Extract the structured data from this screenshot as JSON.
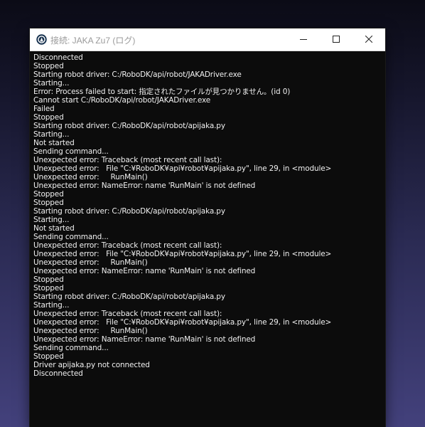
{
  "window": {
    "title": "接続: JAKA Zu7 (ログ)",
    "app_icon": "robodk-logo-icon",
    "controls": {
      "minimize": "minimize-icon",
      "maximize": "maximize-icon",
      "close": "close-icon"
    }
  },
  "colors": {
    "console_background": "#0c0c0c",
    "console_text": "#f0f0f0",
    "titlebar_background": "#ffffff",
    "title_text": "#9a9a9a"
  },
  "log_lines": [
    "Disconnected",
    "Stopped",
    "Starting robot driver: C:/RoboDK/api/robot/JAKADriver.exe",
    "Starting...",
    "Error: Process failed to start: 指定されたファイルが見つかりません。(id 0)",
    "Cannot start C:/RoboDK/api/robot/JAKADriver.exe",
    "Failed",
    "Stopped",
    "Starting robot driver: C:/RoboDK/api/robot/apijaka.py",
    "Starting...",
    "Not started",
    "Sending command...",
    "Unexpected error: Traceback (most recent call last):",
    "Unexpected error:   File \"C:¥RoboDK¥api¥robot¥apijaka.py\", line 29, in <module>",
    "Unexpected error:     RunMain()",
    "Unexpected error: NameError: name 'RunMain' is not defined",
    "Stopped",
    "Stopped",
    "Starting robot driver: C:/RoboDK/api/robot/apijaka.py",
    "Starting...",
    "Not started",
    "Sending command...",
    "Unexpected error: Traceback (most recent call last):",
    "Unexpected error:   File \"C:¥RoboDK¥api¥robot¥apijaka.py\", line 29, in <module>",
    "Unexpected error:     RunMain()",
    "Unexpected error: NameError: name 'RunMain' is not defined",
    "Stopped",
    "Stopped",
    "Starting robot driver: C:/RoboDK/api/robot/apijaka.py",
    "Starting...",
    "Unexpected error: Traceback (most recent call last):",
    "Unexpected error:   File \"C:¥RoboDK¥api¥robot¥apijaka.py\", line 29, in <module>",
    "Unexpected error:     RunMain()",
    "Unexpected error: NameError: name 'RunMain' is not defined",
    "Sending command...",
    "Stopped",
    "Driver apijaka.py not connected",
    "Disconnected"
  ]
}
